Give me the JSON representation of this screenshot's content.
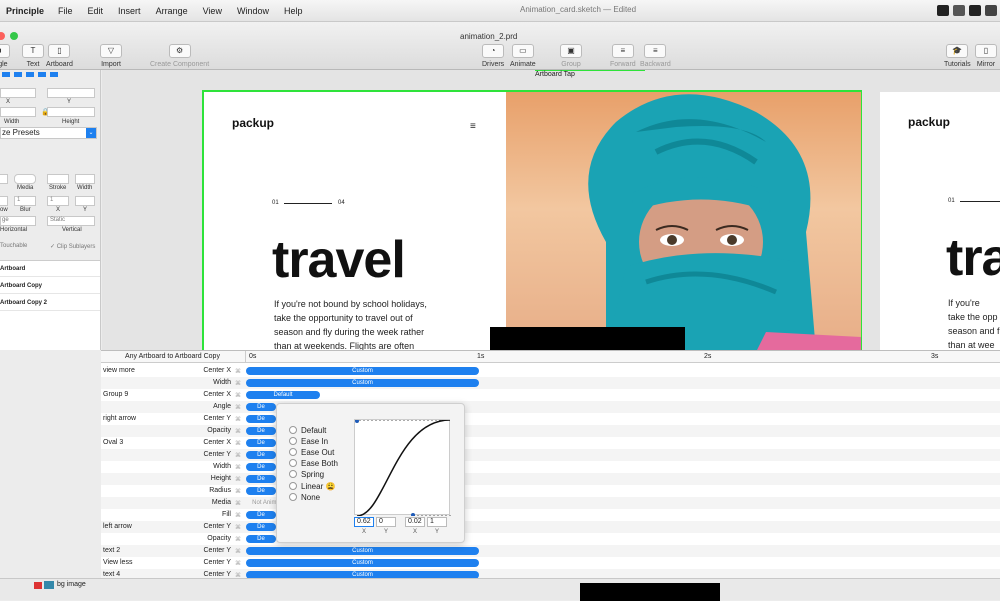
{
  "menubar": {
    "app": "Principle",
    "items": [
      "File",
      "Edit",
      "Insert",
      "Arrange",
      "View",
      "Window",
      "Help"
    ]
  },
  "window": {
    "doc_title": "Animation_card.sketch — Edited",
    "file_title": "animation_2.prd"
  },
  "toolbar": {
    "left": [
      "angle",
      "Text",
      "Artboard",
      "Import",
      "Create Component"
    ],
    "center": [
      "Group",
      "Drivers",
      "Animate",
      "Forward",
      "Backward"
    ],
    "right": [
      "Tutorials",
      "Mirror"
    ]
  },
  "inspector": {
    "x_label": "X",
    "y_label": "Y",
    "width_label": "Width",
    "height_label": "Height",
    "presets": "ze Presets",
    "media": "Media",
    "stroke": "Stroke",
    "width2": "Width",
    "shadow": "ow",
    "blur": "Blur",
    "x2": "X",
    "y2": "Y",
    "blur_val": "1",
    "x_val": "1",
    "horizontal": "Horizontal",
    "vertical": "Vertical",
    "static": "Static",
    "sel1": "ge",
    "touchable": "Touchable",
    "clip": "Clip Sublayers",
    "layers": [
      "Artboard",
      "Artboard Copy",
      "Artboard Copy 2"
    ]
  },
  "canvas": {
    "tap_label": "Artboard Tap",
    "logo": "packup",
    "pager_start": "01",
    "pager_end": "04",
    "headline": "travel",
    "paragraph": [
      "If you're not bound by school holidays,",
      "take the opportunity to travel out of",
      "season and fly during the week rather",
      "than at weekends. Flights are often"
    ],
    "paragraph2": [
      "If you're",
      "take the opp",
      "season and f",
      "than at wee"
    ],
    "headline2": "tra"
  },
  "timeline": {
    "header": "Any Artboard to Artboard Copy",
    "ticks": [
      "0s",
      "1s",
      "2s",
      "3s"
    ],
    "rows": [
      {
        "name": "view more",
        "prop": "Center X",
        "bar": "Custom"
      },
      {
        "name": "",
        "prop": "Width",
        "bar": "Custom"
      },
      {
        "name": "Group 9",
        "prop": "Center X",
        "bar": "Default"
      },
      {
        "name": "",
        "prop": "Angle",
        "bar": "De"
      },
      {
        "name": "right arrow",
        "prop": "Center Y",
        "bar": "De"
      },
      {
        "name": "",
        "prop": "Opacity",
        "bar": "De"
      },
      {
        "name": "Oval 3",
        "prop": "Center X",
        "bar": "De"
      },
      {
        "name": "",
        "prop": "Center Y",
        "bar": "De"
      },
      {
        "name": "",
        "prop": "Width",
        "bar": "De"
      },
      {
        "name": "",
        "prop": "Height",
        "bar": "De"
      },
      {
        "name": "",
        "prop": "Radius",
        "bar": "De"
      },
      {
        "name": "",
        "prop": "Media",
        "bar": "Not Anima"
      },
      {
        "name": "",
        "prop": "Fill",
        "bar": "De"
      },
      {
        "name": "left arrow",
        "prop": "Center Y",
        "bar": "De"
      },
      {
        "name": "",
        "prop": "Opacity",
        "bar": "De"
      },
      {
        "name": "text 2",
        "prop": "Center Y",
        "bar": "Custom"
      },
      {
        "name": "View less",
        "prop": "Center Y",
        "bar": "Custom"
      },
      {
        "name": "text 4",
        "prop": "Center Y",
        "bar": "Custom"
      }
    ]
  },
  "popover": {
    "options": [
      "Default",
      "Ease In",
      "Ease Out",
      "Ease Both",
      "Spring",
      "Linear 😩",
      "None"
    ],
    "x1": "0.62",
    "y1": "0",
    "x2": "0.02",
    "y2": "1",
    "lbl_x": "X",
    "lbl_y": "Y"
  },
  "bottom": {
    "layer": "bg image"
  },
  "colors": {
    "accent": "#1e80ef",
    "selection": "#2ee33a",
    "scarf": "#1aa3b4"
  }
}
